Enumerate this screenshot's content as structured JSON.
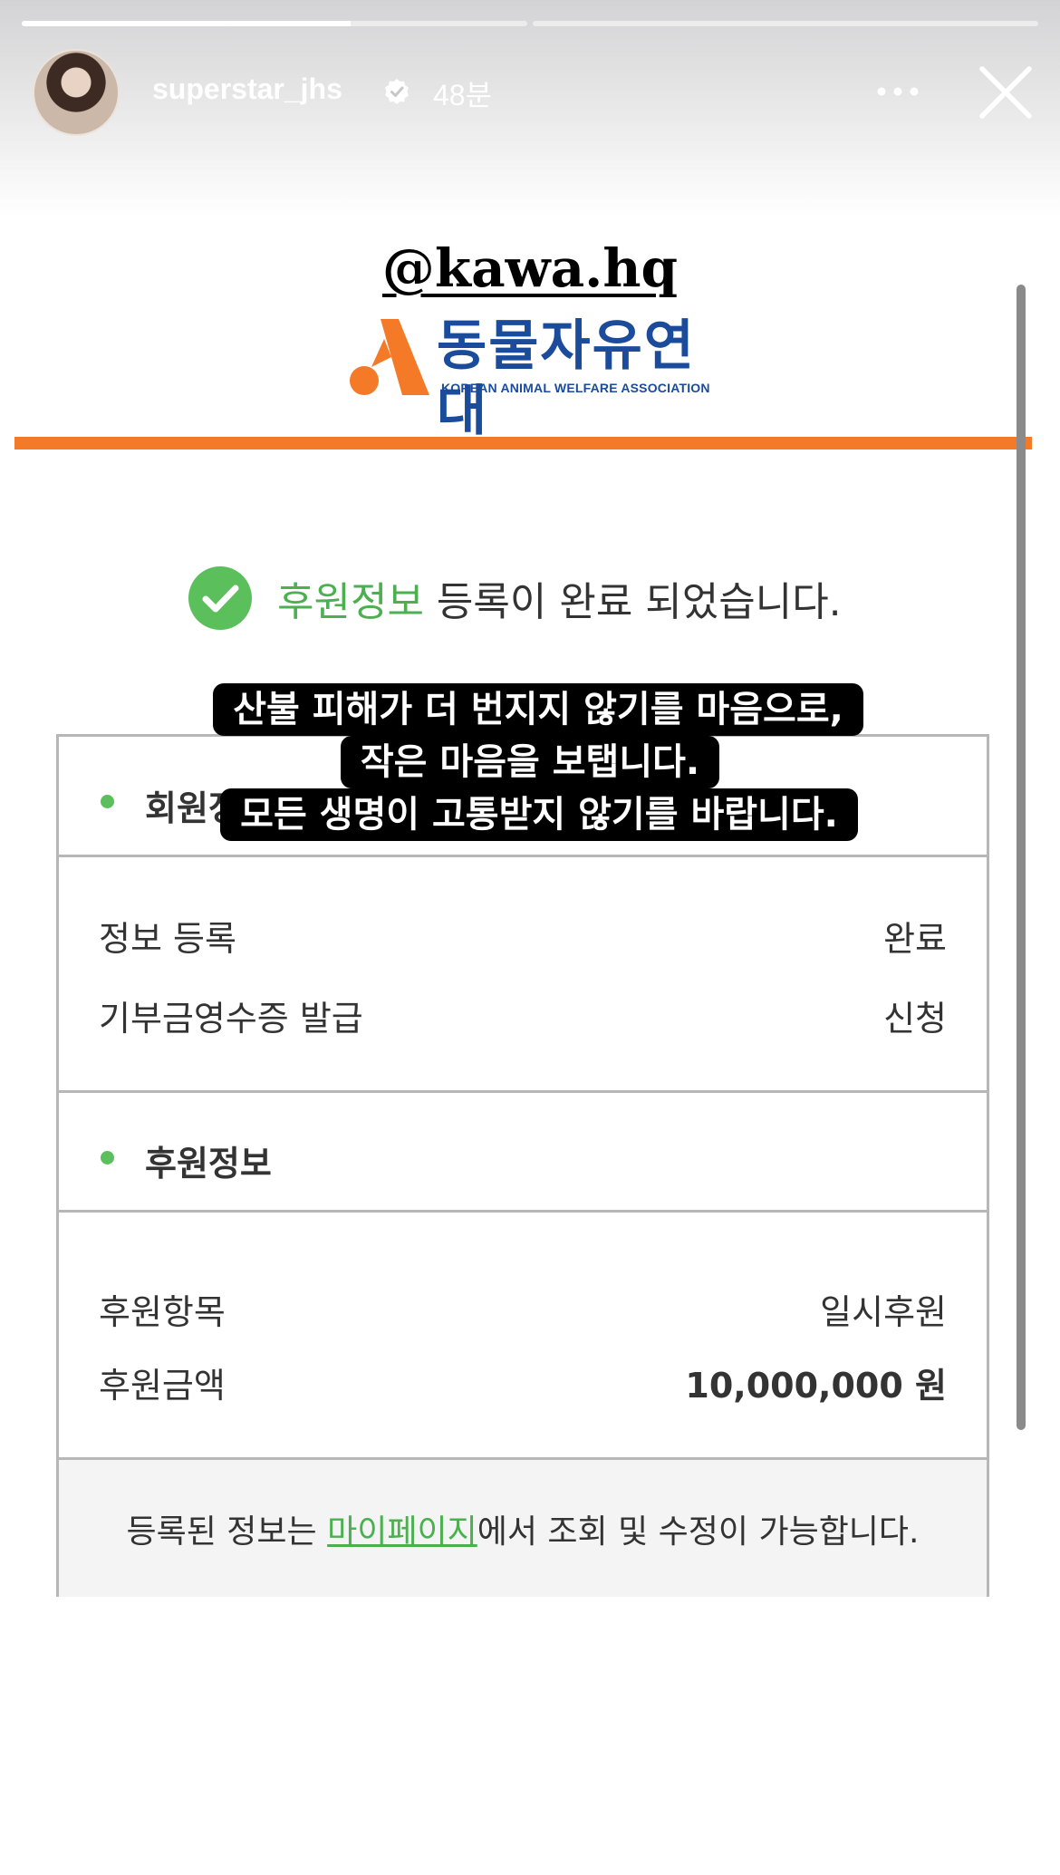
{
  "story": {
    "progress_segments": [
      {
        "fraction": 0.65
      },
      {
        "fraction": 0.0
      }
    ],
    "username": "superstar_jhs",
    "time_ago": "48분",
    "verified_icon": "verified-badge-icon",
    "more_icon": "more-dots-icon",
    "close_icon": "close-icon"
  },
  "overlay": {
    "mention": "@kawa.hq",
    "caption_lines": [
      "산불 피해가 더 번지지 않기를 마음으로,",
      "작은 마음을 보탭니다.",
      "모든 생명이 고통받지 않기를 바랍니다."
    ]
  },
  "page": {
    "logo_name": "동물자유연대",
    "logo_sub": "KOREAN ANIMAL WELFARE ASSOCIATION",
    "accent_color": "#f47a28",
    "completion": {
      "highlight": "후원정보",
      "rest": " 등록이 완료 되었습니다."
    },
    "member_section": {
      "title": "회원정보",
      "rows": [
        {
          "label": "정보 등록",
          "value": "완료"
        },
        {
          "label": "기부금영수증 발급",
          "value": "신청"
        }
      ]
    },
    "donation_section": {
      "title": "후원정보",
      "rows": [
        {
          "label": "후원항목",
          "value": "일시후원"
        },
        {
          "label": "후원금액",
          "value": "10,000,000 원"
        }
      ]
    },
    "footer": {
      "pre": "등록된 정보는 ",
      "link": "마이페이지",
      "post": "에서 조회 및 수정이 가능합니다."
    }
  }
}
